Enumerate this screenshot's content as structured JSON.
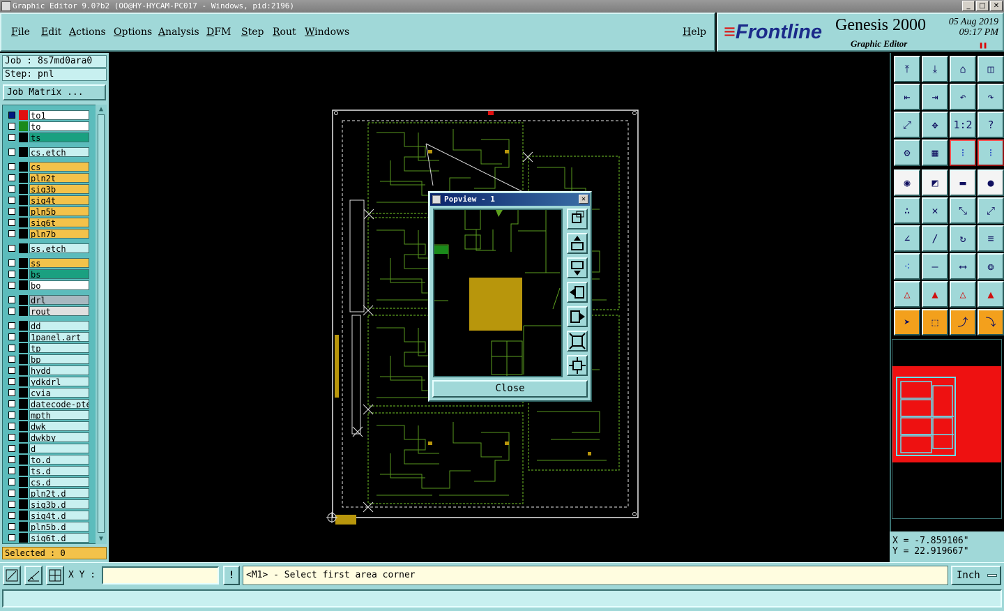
{
  "window": {
    "title": "Graphic Editor 9.0?b2 (OO@HY-HYCAM-PC017 - Windows, pid:2196)",
    "buttons": [
      "_",
      "□",
      "✕"
    ]
  },
  "menu": {
    "items": [
      "File",
      "Edit",
      "Actions",
      "Options",
      "Analysis",
      "DFM",
      "Step",
      "Rout",
      "Windows"
    ],
    "help": "Help"
  },
  "brand": {
    "logo": "Frontline",
    "product": "Genesis 2000",
    "subtitle": "Graphic Editor",
    "date": "05 Aug 2019",
    "time": "09:17 PM"
  },
  "job": {
    "job_label": "Job : 8s7md0ara0",
    "step_label": "Step: pnl",
    "matrix_button": "Job Matrix ..."
  },
  "layers": [
    {
      "name": "to1",
      "color": "#ffffff",
      "swatch": "#e01010",
      "checked": true
    },
    {
      "name": "to",
      "color": "#ffffff",
      "swatch": "#1a8a1a",
      "checked": false
    },
    {
      "name": "ts",
      "color": "#1aa080",
      "swatch": "#000000",
      "checked": false
    },
    {
      "name": "cs.etch",
      "color": "#c8f0f0",
      "swatch": "#000000",
      "checked": false
    },
    {
      "name": "cs",
      "color": "#f3c24a",
      "swatch": "#000000",
      "checked": false
    },
    {
      "name": "pln2t",
      "color": "#f3c24a",
      "swatch": "#000000",
      "checked": false
    },
    {
      "name": "sig3b",
      "color": "#f3c24a",
      "swatch": "#000000",
      "checked": false
    },
    {
      "name": "sig4t",
      "color": "#f3c24a",
      "swatch": "#000000",
      "checked": false
    },
    {
      "name": "pln5b",
      "color": "#f3c24a",
      "swatch": "#000000",
      "checked": false
    },
    {
      "name": "sig6t",
      "color": "#f3c24a",
      "swatch": "#000000",
      "checked": false
    },
    {
      "name": "pln7b",
      "color": "#f3c24a",
      "swatch": "#000000",
      "checked": false
    },
    {
      "name": "ss.etch",
      "color": "#c8f0f0",
      "swatch": "#000000",
      "checked": false
    },
    {
      "name": "ss",
      "color": "#f3c24a",
      "swatch": "#000000",
      "checked": false
    },
    {
      "name": "bs",
      "color": "#1aa080",
      "swatch": "#000000",
      "checked": false
    },
    {
      "name": "bo",
      "color": "#ffffff",
      "swatch": "#000000",
      "checked": false
    },
    {
      "name": "drl",
      "color": "#a8b8c0",
      "swatch": "#000000",
      "checked": false
    },
    {
      "name": "rout",
      "color": "#e0e0e0",
      "swatch": "#000000",
      "checked": false
    },
    {
      "name": "dd",
      "color": "#c8f0f0",
      "swatch": "#000000",
      "checked": false
    },
    {
      "name": "1panel.art",
      "color": "#c8f0f0",
      "swatch": "#000000",
      "checked": false
    },
    {
      "name": "tp",
      "color": "#c8f0f0",
      "swatch": "#000000",
      "checked": false
    },
    {
      "name": "bp",
      "color": "#c8f0f0",
      "swatch": "#000000",
      "checked": false
    },
    {
      "name": "hydd",
      "color": "#c8f0f0",
      "swatch": "#000000",
      "checked": false
    },
    {
      "name": "ydkdrl",
      "color": "#c8f0f0",
      "swatch": "#000000",
      "checked": false
    },
    {
      "name": "cvia",
      "color": "#c8f0f0",
      "swatch": "#000000",
      "checked": false
    },
    {
      "name": "datecode-pte",
      "color": "#c8f0f0",
      "swatch": "#000000",
      "checked": false
    },
    {
      "name": "mpth",
      "color": "#c8f0f0",
      "swatch": "#000000",
      "checked": false
    },
    {
      "name": "dwk",
      "color": "#c8f0f0",
      "swatch": "#000000",
      "checked": false
    },
    {
      "name": "dwkby",
      "color": "#c8f0f0",
      "swatch": "#000000",
      "checked": false
    },
    {
      "name": "d",
      "color": "#c8f0f0",
      "swatch": "#000000",
      "checked": false
    },
    {
      "name": "to.d",
      "color": "#c8f0f0",
      "swatch": "#000000",
      "checked": false
    },
    {
      "name": "ts.d",
      "color": "#c8f0f0",
      "swatch": "#000000",
      "checked": false
    },
    {
      "name": "cs.d",
      "color": "#c8f0f0",
      "swatch": "#000000",
      "checked": false
    },
    {
      "name": "pln2t.d",
      "color": "#c8f0f0",
      "swatch": "#000000",
      "checked": false
    },
    {
      "name": "sig3b.d",
      "color": "#c8f0f0",
      "swatch": "#000000",
      "checked": false
    },
    {
      "name": "sig4t.d",
      "color": "#c8f0f0",
      "swatch": "#000000",
      "checked": false
    },
    {
      "name": "pln5b.d",
      "color": "#c8f0f0",
      "swatch": "#000000",
      "checked": false
    },
    {
      "name": "sig6t.d",
      "color": "#c8f0f0",
      "swatch": "#000000",
      "checked": false
    }
  ],
  "selected": "Selected : 0",
  "popview": {
    "title": "Popview - 1",
    "close_button": "Close"
  },
  "coords": {
    "x": "X = -7.859106\"",
    "y": "Y = 22.919667\""
  },
  "status": {
    "xy_label": "X Y :",
    "xy_value": "",
    "bang": "!",
    "prompt": "<M1> - Select first area corner",
    "units": "Inch"
  },
  "colors": {
    "panel": "#a0d8d8",
    "trace": "#5da020",
    "pad": "#b8960c",
    "highlight": "#f3c24a"
  }
}
